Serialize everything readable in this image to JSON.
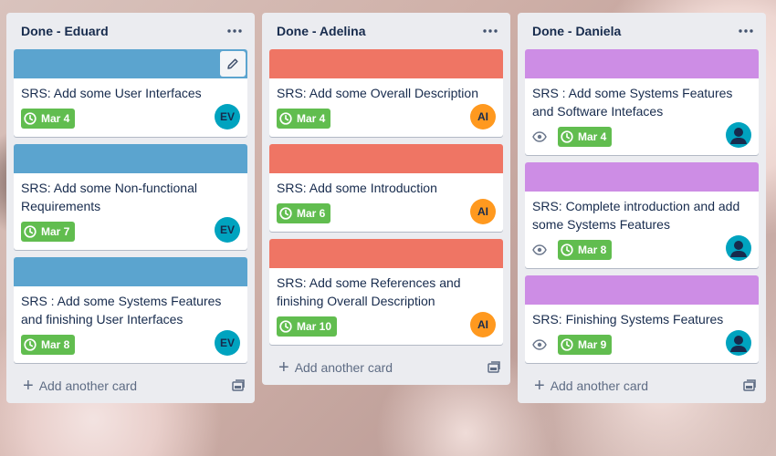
{
  "colors": {
    "eduard_cover": "#5ba4cf",
    "adelina_cover": "#ef7564",
    "daniela_cover": "#cd8de5",
    "due_badge": "#61bd4f"
  },
  "lists": [
    {
      "title": "Done - Eduard",
      "add_card_label": "Add another card",
      "cards": [
        {
          "title": "SRS: Add some User Interfaces",
          "due": "Mar 4",
          "avatar": "EV"
        },
        {
          "title": "SRS: Add some Non-functional Requirements",
          "due": "Mar 7",
          "avatar": "EV"
        },
        {
          "title": "SRS : Add some Systems Features and finishing User Interfaces",
          "due": "Mar 8",
          "avatar": "EV"
        }
      ]
    },
    {
      "title": "Done - Adelina",
      "add_card_label": "Add another card",
      "cards": [
        {
          "title": "SRS: Add some Overall Description",
          "due": "Mar 4",
          "avatar": "AI"
        },
        {
          "title": "SRS: Add some Introduction",
          "due": "Mar 6",
          "avatar": "AI"
        },
        {
          "title": "SRS: Add some References and finishing Overall Description",
          "due": "Mar 10",
          "avatar": "AI"
        }
      ]
    },
    {
      "title": "Done - Daniela",
      "add_card_label": "Add another card",
      "cards": [
        {
          "title": "SRS : Add some Systems Features and Software Intefaces",
          "due": "Mar 4"
        },
        {
          "title": "SRS: Complete introduction and add some Systems Features",
          "due": "Mar 8"
        },
        {
          "title": "SRS: Finishing Systems Features",
          "due": "Mar 9"
        }
      ]
    }
  ]
}
